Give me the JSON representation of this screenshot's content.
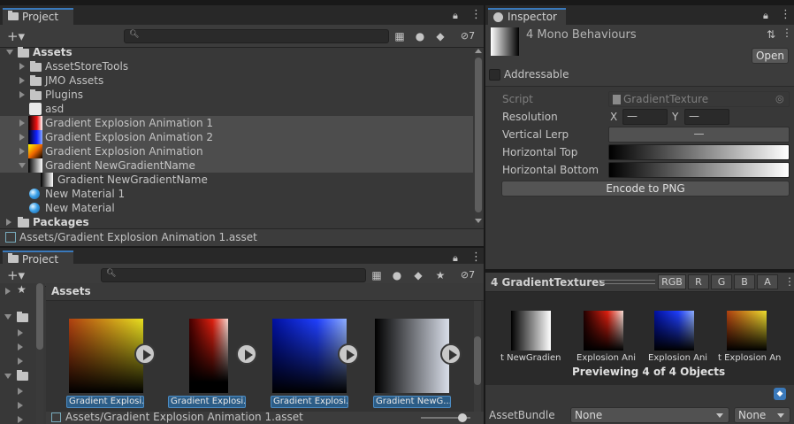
{
  "project_top": {
    "tab": "Project",
    "hidden_count": "7",
    "tree": {
      "assets": "Assets",
      "items": [
        "AssetStoreTools",
        "JMO Assets",
        "Plugins",
        "asd",
        "Gradient Explosion Animation 1",
        "Gradient Explosion Animation 2",
        "Gradient Explosion Animation",
        "Gradient NewGradientName",
        "Gradient NewGradientName",
        "New Material 1",
        "New Material"
      ],
      "packages": "Packages"
    },
    "status_path": "Assets/Gradient Explosion Animation 1.asset"
  },
  "project_bottom": {
    "tab": "Project",
    "hidden_count": "7",
    "header": "Assets",
    "thumbs": [
      "Gradient Explosi...",
      "Gradient Explosi...",
      "Gradient Explosi...",
      "Gradient NewG..."
    ],
    "status_path": "Assets/Gradient Explosion Animation 1.asset"
  },
  "inspector": {
    "tab": "Inspector",
    "title": "4 Mono Behaviours",
    "open_label": "Open",
    "addressable_label": "Addressable",
    "script_label": "Script",
    "script_value": "GradientTexture",
    "resolution_label": "Resolution",
    "res_x_label": "X",
    "res_x_value": "—",
    "res_y_label": "Y",
    "res_y_value": "—",
    "vertical_lerp_label": "Vertical Lerp",
    "vertical_lerp_value": "—",
    "horizontal_top_label": "Horizontal Top",
    "horizontal_bottom_label": "Horizontal Bottom",
    "encode_label": "Encode to PNG"
  },
  "preview": {
    "title": "4 GradientTextures",
    "channels": [
      "RGB",
      "R",
      "G",
      "B",
      "A"
    ],
    "thumbs": [
      "t NewGradien",
      "Explosion Ani",
      "Explosion Ani",
      "t Explosion An"
    ],
    "caption": "Previewing 4 of 4 Objects"
  },
  "assetbundle": {
    "label": "AssetBundle",
    "value": "None",
    "variant": "None"
  }
}
